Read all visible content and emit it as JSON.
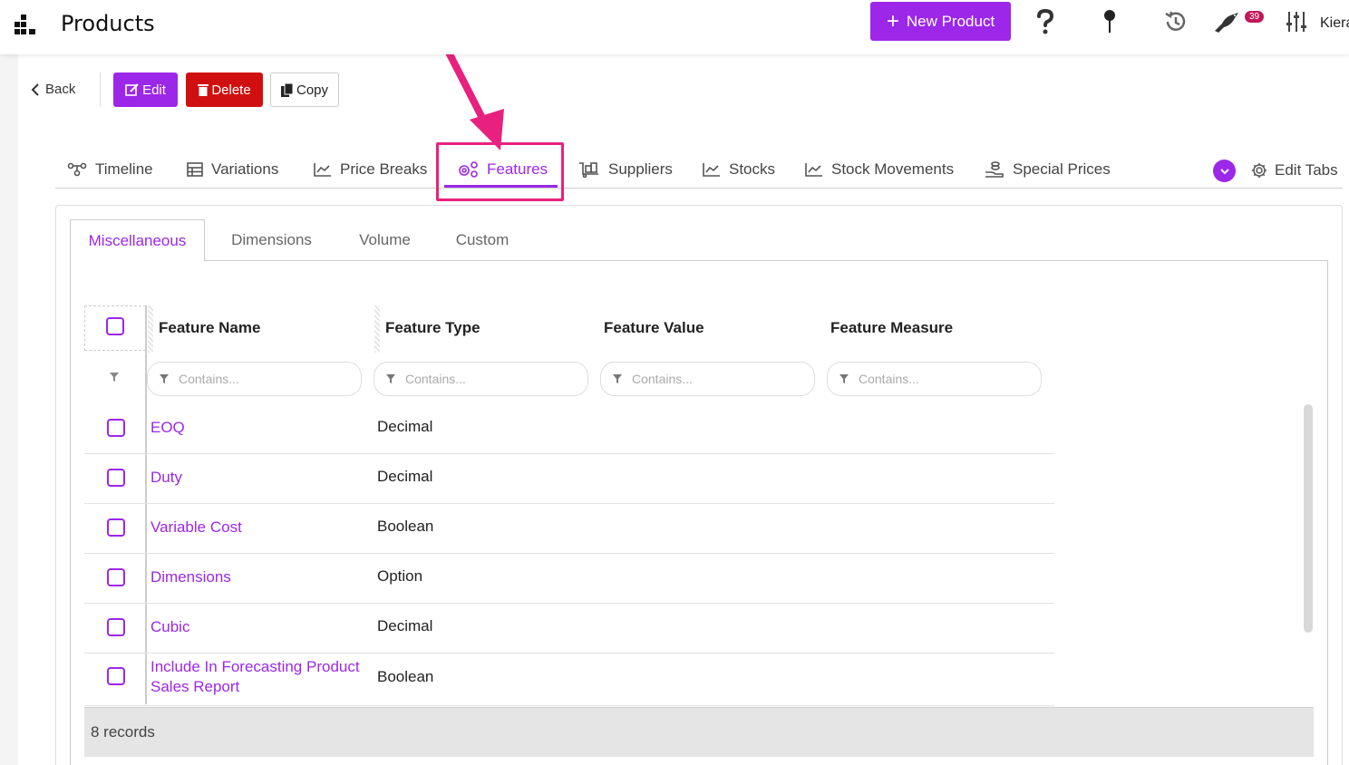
{
  "header": {
    "title": "Products",
    "new_button_label": "New Product",
    "notification_count": "39",
    "user_name": "Kieran"
  },
  "actions": {
    "back_label": "Back",
    "edit_label": "Edit",
    "delete_label": "Delete",
    "copy_label": "Copy"
  },
  "main_tabs": [
    {
      "label": "Timeline",
      "icon": "timeline-icon"
    },
    {
      "label": "Variations",
      "icon": "table-icon"
    },
    {
      "label": "Price Breaks",
      "icon": "line-chart-icon"
    },
    {
      "label": "Features",
      "icon": "gears-icon",
      "active": true
    },
    {
      "label": "Suppliers",
      "icon": "dolly-icon"
    },
    {
      "label": "Stocks",
      "icon": "line-chart-icon"
    },
    {
      "label": "Stock Movements",
      "icon": "line-chart-icon"
    },
    {
      "label": "Special Prices",
      "icon": "hand-coins-icon"
    }
  ],
  "edit_tabs_label": "Edit Tabs",
  "sub_tabs": [
    {
      "label": "Miscellaneous",
      "active": true
    },
    {
      "label": "Dimensions"
    },
    {
      "label": "Volume"
    },
    {
      "label": "Custom"
    }
  ],
  "grid": {
    "columns": [
      "Feature Name",
      "Feature Type",
      "Feature Value",
      "Feature Measure"
    ],
    "filter_placeholder": "Contains...",
    "rows": [
      {
        "name": "EOQ",
        "type": "Decimal"
      },
      {
        "name": "Duty",
        "type": "Decimal"
      },
      {
        "name": "Variable Cost",
        "type": "Boolean"
      },
      {
        "name": "Dimensions",
        "type": "Option"
      },
      {
        "name": "Cubic",
        "type": "Decimal"
      },
      {
        "name": "Include In Forecasting Product Sales Report",
        "type": "Boolean"
      }
    ],
    "footer": "8 records"
  },
  "colors": {
    "accent": "#9c27e8",
    "danger": "#d01010",
    "highlight": "#e8217f",
    "badge": "#c2185b"
  }
}
